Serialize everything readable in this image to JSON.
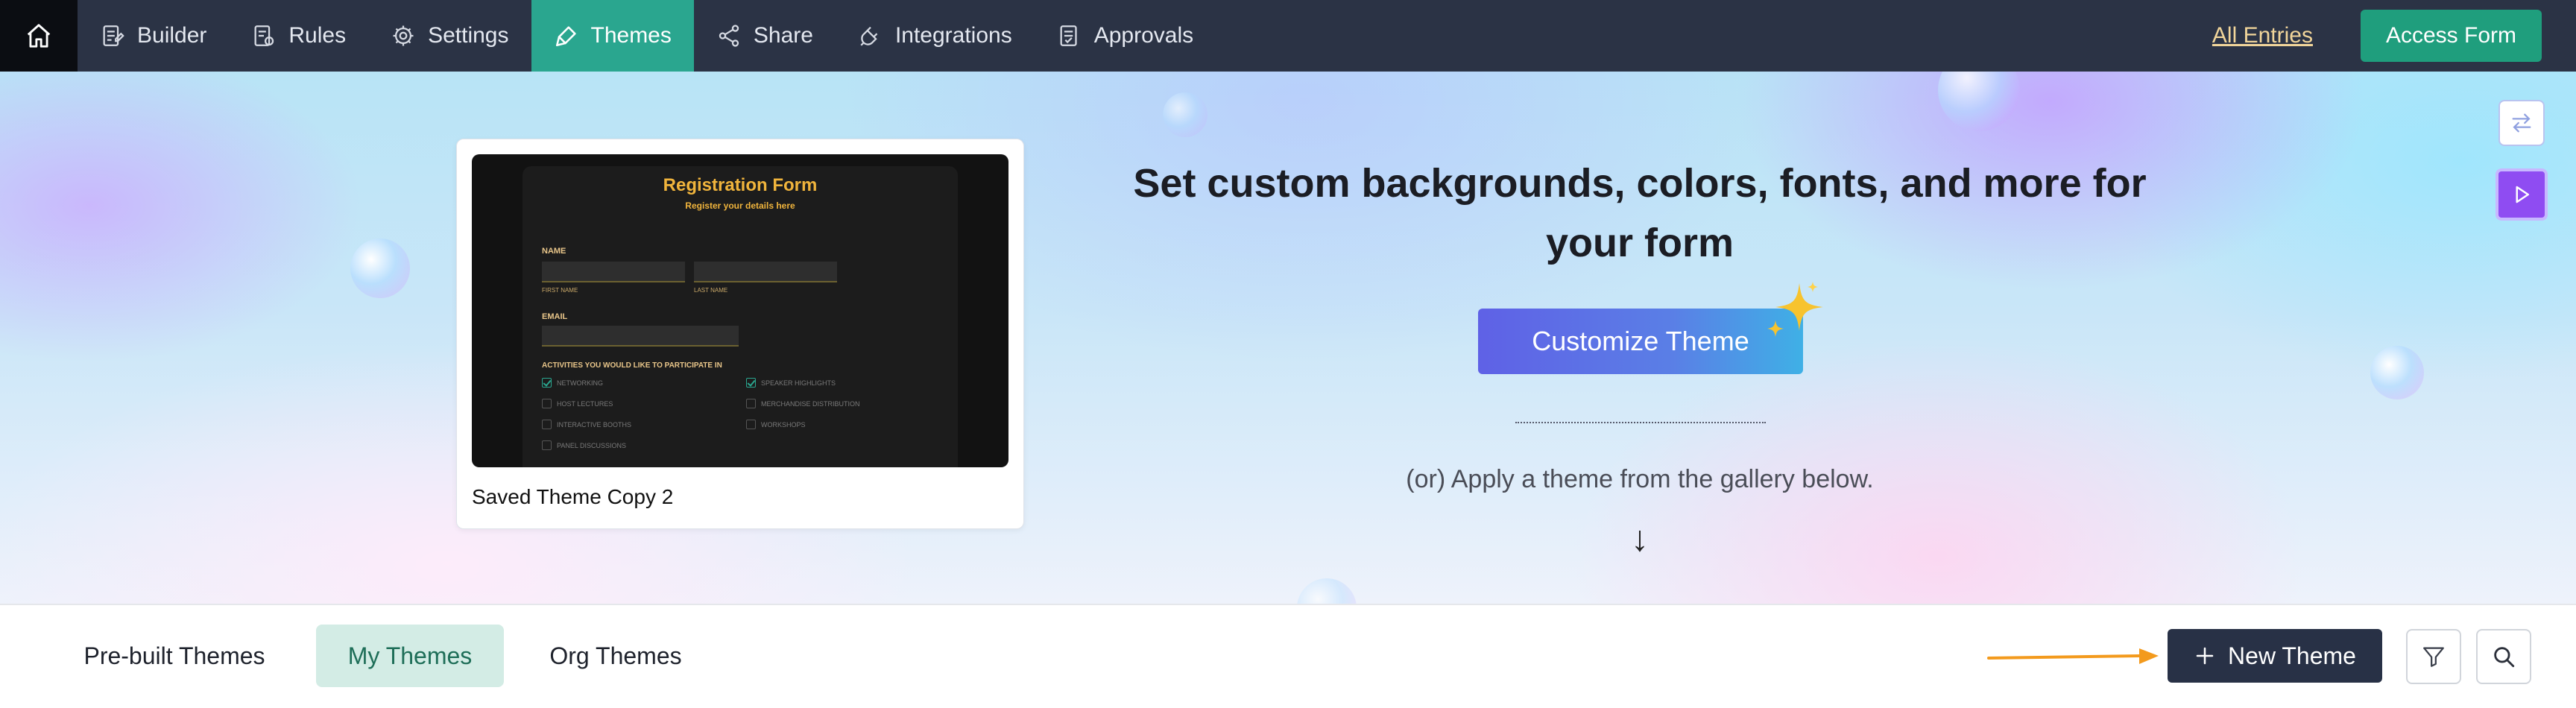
{
  "nav": {
    "items": [
      {
        "label": "Builder",
        "icon": "builder-icon"
      },
      {
        "label": "Rules",
        "icon": "rules-icon"
      },
      {
        "label": "Settings",
        "icon": "gear-icon"
      },
      {
        "label": "Themes",
        "icon": "brush-icon",
        "active": true
      },
      {
        "label": "Share",
        "icon": "share-icon"
      },
      {
        "label": "Integrations",
        "icon": "plug-icon"
      },
      {
        "label": "Approvals",
        "icon": "approvals-icon"
      }
    ],
    "all_entries": "All Entries",
    "access_form": "Access Form"
  },
  "hero": {
    "headline": "Set custom backgrounds, colors, fonts, and more for your form",
    "customize_button": "Customize Theme",
    "gallery_text": "(or) Apply a theme from the gallery below.",
    "down_arrow": "↓"
  },
  "theme_card": {
    "name": "Saved Theme Copy 2",
    "preview": {
      "title": "Registration Form",
      "subtitle": "Register your details here",
      "name_label": "NAME",
      "first_name": "FIRST NAME",
      "last_name": "LAST NAME",
      "email_label": "EMAIL",
      "activities_label": "ACTIVITIES YOU WOULD LIKE TO PARTICIPATE IN",
      "options": [
        {
          "label": "NETWORKING",
          "checked": true
        },
        {
          "label": "SPEAKER HIGHLIGHTS",
          "checked": true
        },
        {
          "label": "HOST LECTURES",
          "checked": false
        },
        {
          "label": "MERCHANDISE DISTRIBUTION",
          "checked": false
        },
        {
          "label": "INTERACTIVE BOOTHS",
          "checked": false
        },
        {
          "label": "WORKSHOPS",
          "checked": false
        },
        {
          "label": "PANEL DISCUSSIONS",
          "checked": false
        }
      ]
    }
  },
  "tabs": [
    {
      "label": "Pre-built Themes"
    },
    {
      "label": "My Themes",
      "active": true
    },
    {
      "label": "Org Themes"
    }
  ],
  "toolbar": {
    "new_theme": "New Theme"
  },
  "colors": {
    "nav_bg": "#2b3345",
    "accent": "#2aa68f",
    "access_button": "#1f9e7d",
    "new_theme_button": "#283146",
    "annotation_arrow": "#f39a1d"
  }
}
